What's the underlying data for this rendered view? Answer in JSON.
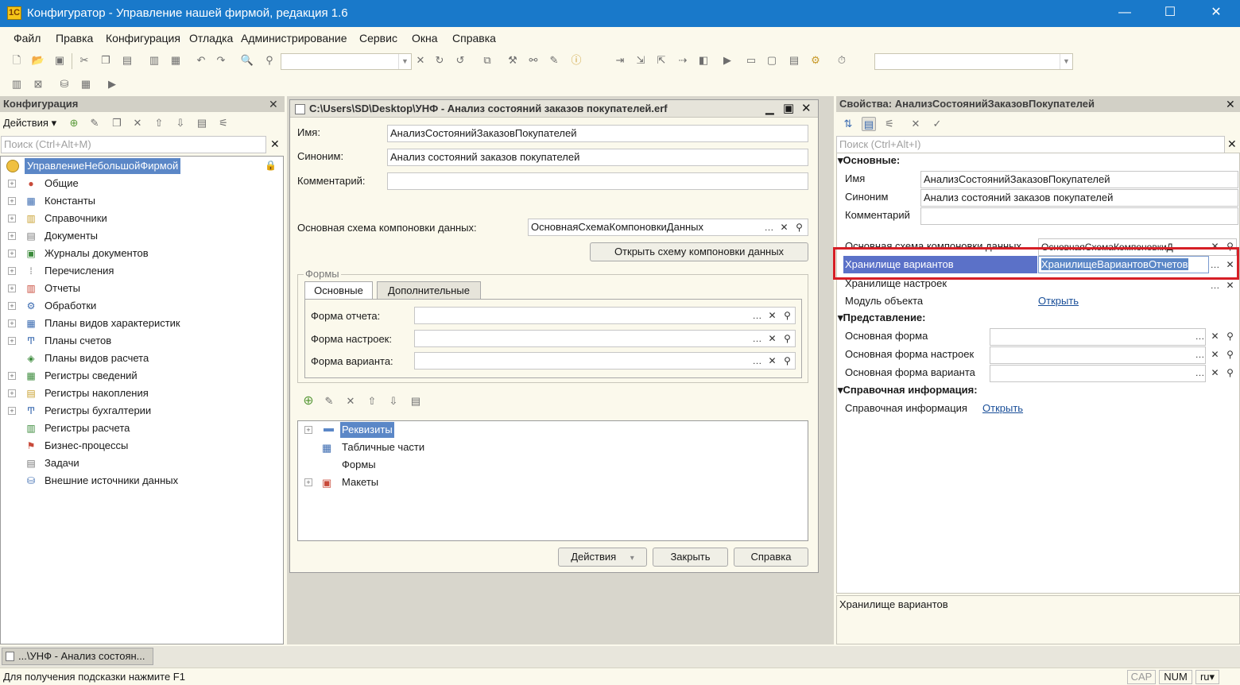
{
  "window": {
    "title": "Конфигуратор - Управление нашей фирмой, редакция 1.6",
    "logo_letter": "1С"
  },
  "menu": [
    "Файл",
    "Правка",
    "Конфигурация",
    "Отладка",
    "Администрирование",
    "Сервис",
    "Окна",
    "Справка"
  ],
  "config_panel": {
    "title": "Конфигурация",
    "actions_label": "Действия",
    "search_placeholder": "Поиск (Ctrl+Alt+M)",
    "root": "УправлениеНебольшойФирмой",
    "items": [
      "Общие",
      "Константы",
      "Справочники",
      "Документы",
      "Журналы документов",
      "Перечисления",
      "Отчеты",
      "Обработки",
      "Планы видов характеристик",
      "Планы счетов",
      "Планы видов расчета",
      "Регистры сведений",
      "Регистры накопления",
      "Регистры бухгалтерии",
      "Регистры расчета",
      "Бизнес-процессы",
      "Задачи",
      "Внешние источники данных"
    ]
  },
  "editor": {
    "title": "C:\\Users\\SD\\Desktop\\УНФ - Анализ состояний заказов покупателей.erf",
    "name_label": "Имя:",
    "name_value": "АнализСостоянийЗаказовПокупателей",
    "synonym_label": "Синоним:",
    "synonym_value": "Анализ состояний заказов покупателей",
    "comment_label": "Комментарий:",
    "comment_value": "",
    "scheme_label": "Основная схема компоновки данных:",
    "scheme_value": "ОсновнаяСхемаКомпоновкиДанных",
    "open_scheme_button": "Открыть схему компоновки данных",
    "forms_group": "Формы",
    "tab_main": "Основные",
    "tab_extra": "Дополнительные",
    "report_form_label": "Форма отчета:",
    "settings_form_label": "Форма настроек:",
    "variant_form_label": "Форма варианта:",
    "tree": [
      "Реквизиты",
      "Табличные части",
      "Формы",
      "Макеты"
    ],
    "actions_button": "Действия",
    "close_button": "Закрыть",
    "help_button": "Справка"
  },
  "props": {
    "title": "Свойства: АнализСостоянийЗаказовПокупателей",
    "search_placeholder": "Поиск (Ctrl+Alt+I)",
    "section_main": "Основные:",
    "name_label": "Имя",
    "name_value": "АнализСостоянийЗаказовПокупателей",
    "synonym_label": "Синоним",
    "synonym_value": "Анализ состояний заказов покупателей",
    "comment_label": "Комментарий",
    "scheme_label": "Основная схема компоновки данных",
    "scheme_value": "ОсновнаяСхемаКомпоновкиД",
    "variants_label": "Хранилище вариантов",
    "variants_value": "ХранилищеВариантовОтчетов",
    "settings_store_label": "Хранилище настроек",
    "module_label": "Модуль объекта",
    "module_link": "Открыть",
    "section_view": "Представление:",
    "main_form_label": "Основная форма",
    "main_settings_form_label": "Основная форма настроек",
    "main_variant_form_label": "Основная форма варианта",
    "section_help": "Справочная информация:",
    "help_label": "Справочная информация",
    "help_link": "Открыть",
    "description": "Хранилище вариантов"
  },
  "taskbar": {
    "item": "...\\УНФ - Анализ состоян..."
  },
  "status": {
    "hint": "Для получения подсказки нажмите F1",
    "cap": "CAP",
    "num": "NUM",
    "lang": "ru"
  }
}
